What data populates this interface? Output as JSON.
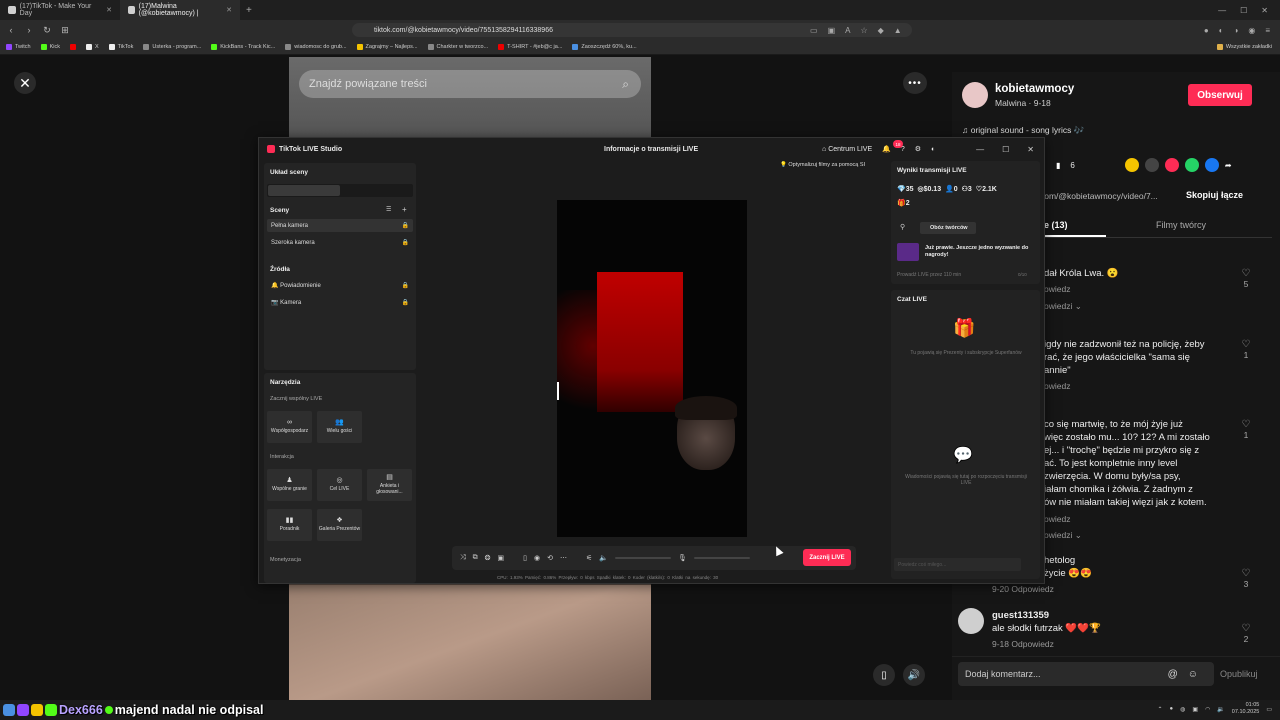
{
  "browser": {
    "tabs": [
      {
        "label": "(17)TikTok - Make Your Day",
        "active": false
      },
      {
        "label": "(17)Malwina (@kobietawmocy) |",
        "active": true
      }
    ],
    "url": "tiktok.com/@kobietawmocy/video/7551358294116338966",
    "bookmarks": [
      "Twitch",
      "Kick",
      "X",
      "TikTok",
      "Usterka - program...",
      "KickBans - Track Kic...",
      "wiadomosc do grub...",
      "Zagrajmy – Najleps...",
      "Charkter w tworzco...",
      "T-SHIRT - #jeb@c ja...",
      "Zaoszczędź 60%, ku..."
    ],
    "bookmarks_right": "Wszystkie zakładki"
  },
  "page": {
    "search_placeholder": "Znajdź powiązane treści",
    "more": "•••"
  },
  "creator": {
    "username": "kobietawmocy",
    "subtitle": "Malwina · 9-18",
    "follow_label": "Obserwuj",
    "song": "♫  original sound - song lyrics 🎶",
    "bookmark_count": "6",
    "video_url": "com/@kobietawmocy/video/7...",
    "copy_link": "Skopiuj łącze",
    "tab_comments": "e (13)",
    "tab_creator_videos": "Filmy twórcy"
  },
  "comments": [
    {
      "text": "dał Króla Lwa. 😮",
      "sub": "owiedz",
      "sub2": "owiedzi ⌄",
      "likes": "5"
    },
    {
      "text": "igdy nie zadzwonił też na policję, żeby\nrać, że jego właścicielka \"sama się\nannie\"",
      "sub": "owiedz",
      "likes": "1"
    },
    {
      "text": "co się martwię, to że mój żyje już\nwięc zostało mu... 10? 12? A mi zostało\nej... i \"trochę\" będzie mi przykro się z\nać. To jest kompletnie inny level\nzwierzęcia. W domu były/sa psy,\niałam chomika i żółwia. Z żadnym z\nów nie miałam takiej więzi jak z kotem.",
      "sub": "owiedz",
      "sub2": "owiedzi ⌄",
      "likes": "1"
    },
    {
      "text": "hetolog\nżycie 😍😍",
      "sub": "9-20   Odpowiedz",
      "likes": "3"
    },
    {
      "user": "guest131359",
      "text": "ale słodki futrzak ❤️❤️🏆",
      "sub": "9-18   Odpowiedz",
      "likes": "2"
    }
  ],
  "comment_input": {
    "placeholder": "Dodaj komentarz...",
    "publish": "Opublikuj"
  },
  "studio": {
    "app_title": "TikTok LIVE Studio",
    "center_title": "Informacje o transmisji LIVE",
    "live_center": "Centrum LIVE",
    "notif_count": "18",
    "scene_layout": "Układ sceny",
    "scenes_header": "Sceny",
    "scenes": [
      "Pełna kamera",
      "Szeroka kamera"
    ],
    "sources_header": "Źródła",
    "sources": [
      "Powiadomienie",
      "Kamera"
    ],
    "tools_header": "Narzędzia",
    "multi_live": "Zacznij wspólny LIVE",
    "tools_row1": [
      "Współgospodarz",
      "Wielu gości"
    ],
    "interaction_header": "Interakcja",
    "tools_row2": [
      "Wspólne granie",
      "Cel LIVE",
      "Ankieta i głosowani..."
    ],
    "tools_row3": [
      "Poradnik",
      "Galeria Prezentów"
    ],
    "monetization_header": "Monetyzacja",
    "optimize": "💡 Optymalizuj filmy za pomocą SI",
    "results_header": "Wyniki transmisji LIVE",
    "stats": [
      "35",
      "$0.13",
      "0",
      "3",
      "2.1K",
      "2"
    ],
    "creator_camp": "Obóz twórców",
    "challenge": "Już prawie. Jeszcze jedno wyzwanie do nagrody!",
    "live_for": "Prowadź LIVE przez 110 min",
    "live_for_tag": "0/10",
    "chat_header": "Czat LIVE",
    "gifts_hint": "Tu pojawią się Prezenty i subskrypcje Superfanów",
    "messages_hint": "Wiadomości pojawią się tutaj po rozpoczęciu transmisji LIVE",
    "chat_placeholder": "Powiedz coś miłego...",
    "go_live": "Zacznij LIVE",
    "perf_stats": "CPU: 1.93%   Pamięć: 0.86%   Przepływ: 0 kbps   Spadki klatek: 0   Koder (klatki/s): 0   Klatki na sekundę: 30"
  },
  "taskbar": {
    "overlay_user": "Dex666",
    "overlay_msg": "majend nadal nie odpisal",
    "time": "01:05",
    "date": "07.10.2025"
  },
  "colors": {
    "accent": "#fe2c55",
    "bg": "#121212"
  }
}
